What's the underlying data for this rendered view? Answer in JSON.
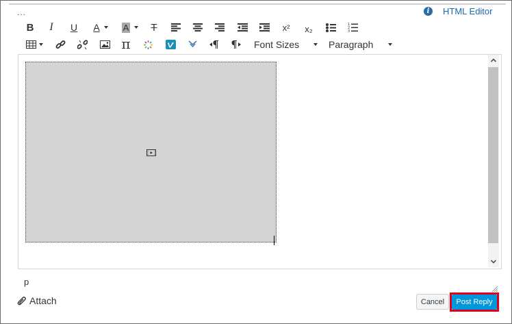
{
  "header": {
    "ellipsis": "...",
    "info_glyph": "i",
    "html_editor_label": "HTML Editor"
  },
  "toolbar": {
    "row1": [
      "bold",
      "italic",
      "underline",
      "text-color",
      "background-color",
      "clear-formatting",
      "align-left",
      "align-center",
      "align-right",
      "outdent",
      "indent",
      "superscript",
      "subscript",
      "bullet-list",
      "numbered-list"
    ],
    "row2": [
      "table",
      "link",
      "unlink",
      "image",
      "math",
      "media-embed",
      "vimeo",
      "collapse",
      "ltr",
      "rtl"
    ],
    "bold_glyph": "B",
    "italic_glyph": "I",
    "underline_glyph": "U",
    "text_color_glyph": "A",
    "bg_color_glyph": "A",
    "clear_glyph": "T",
    "superscript_glyph": "x²",
    "subscript_glyph": "x₂",
    "math_glyph": "π",
    "font_sizes_label": "Font Sizes",
    "paragraph_label": "Paragraph"
  },
  "editor": {
    "content_type": "video-placeholder"
  },
  "status": {
    "path": "p"
  },
  "footer": {
    "attach_label": "Attach",
    "cancel_label": "Cancel",
    "post_reply_label": "Post Reply"
  },
  "colors": {
    "accent": "#0096db",
    "highlight_outline": "#e0001b",
    "link": "#1c66b3"
  }
}
